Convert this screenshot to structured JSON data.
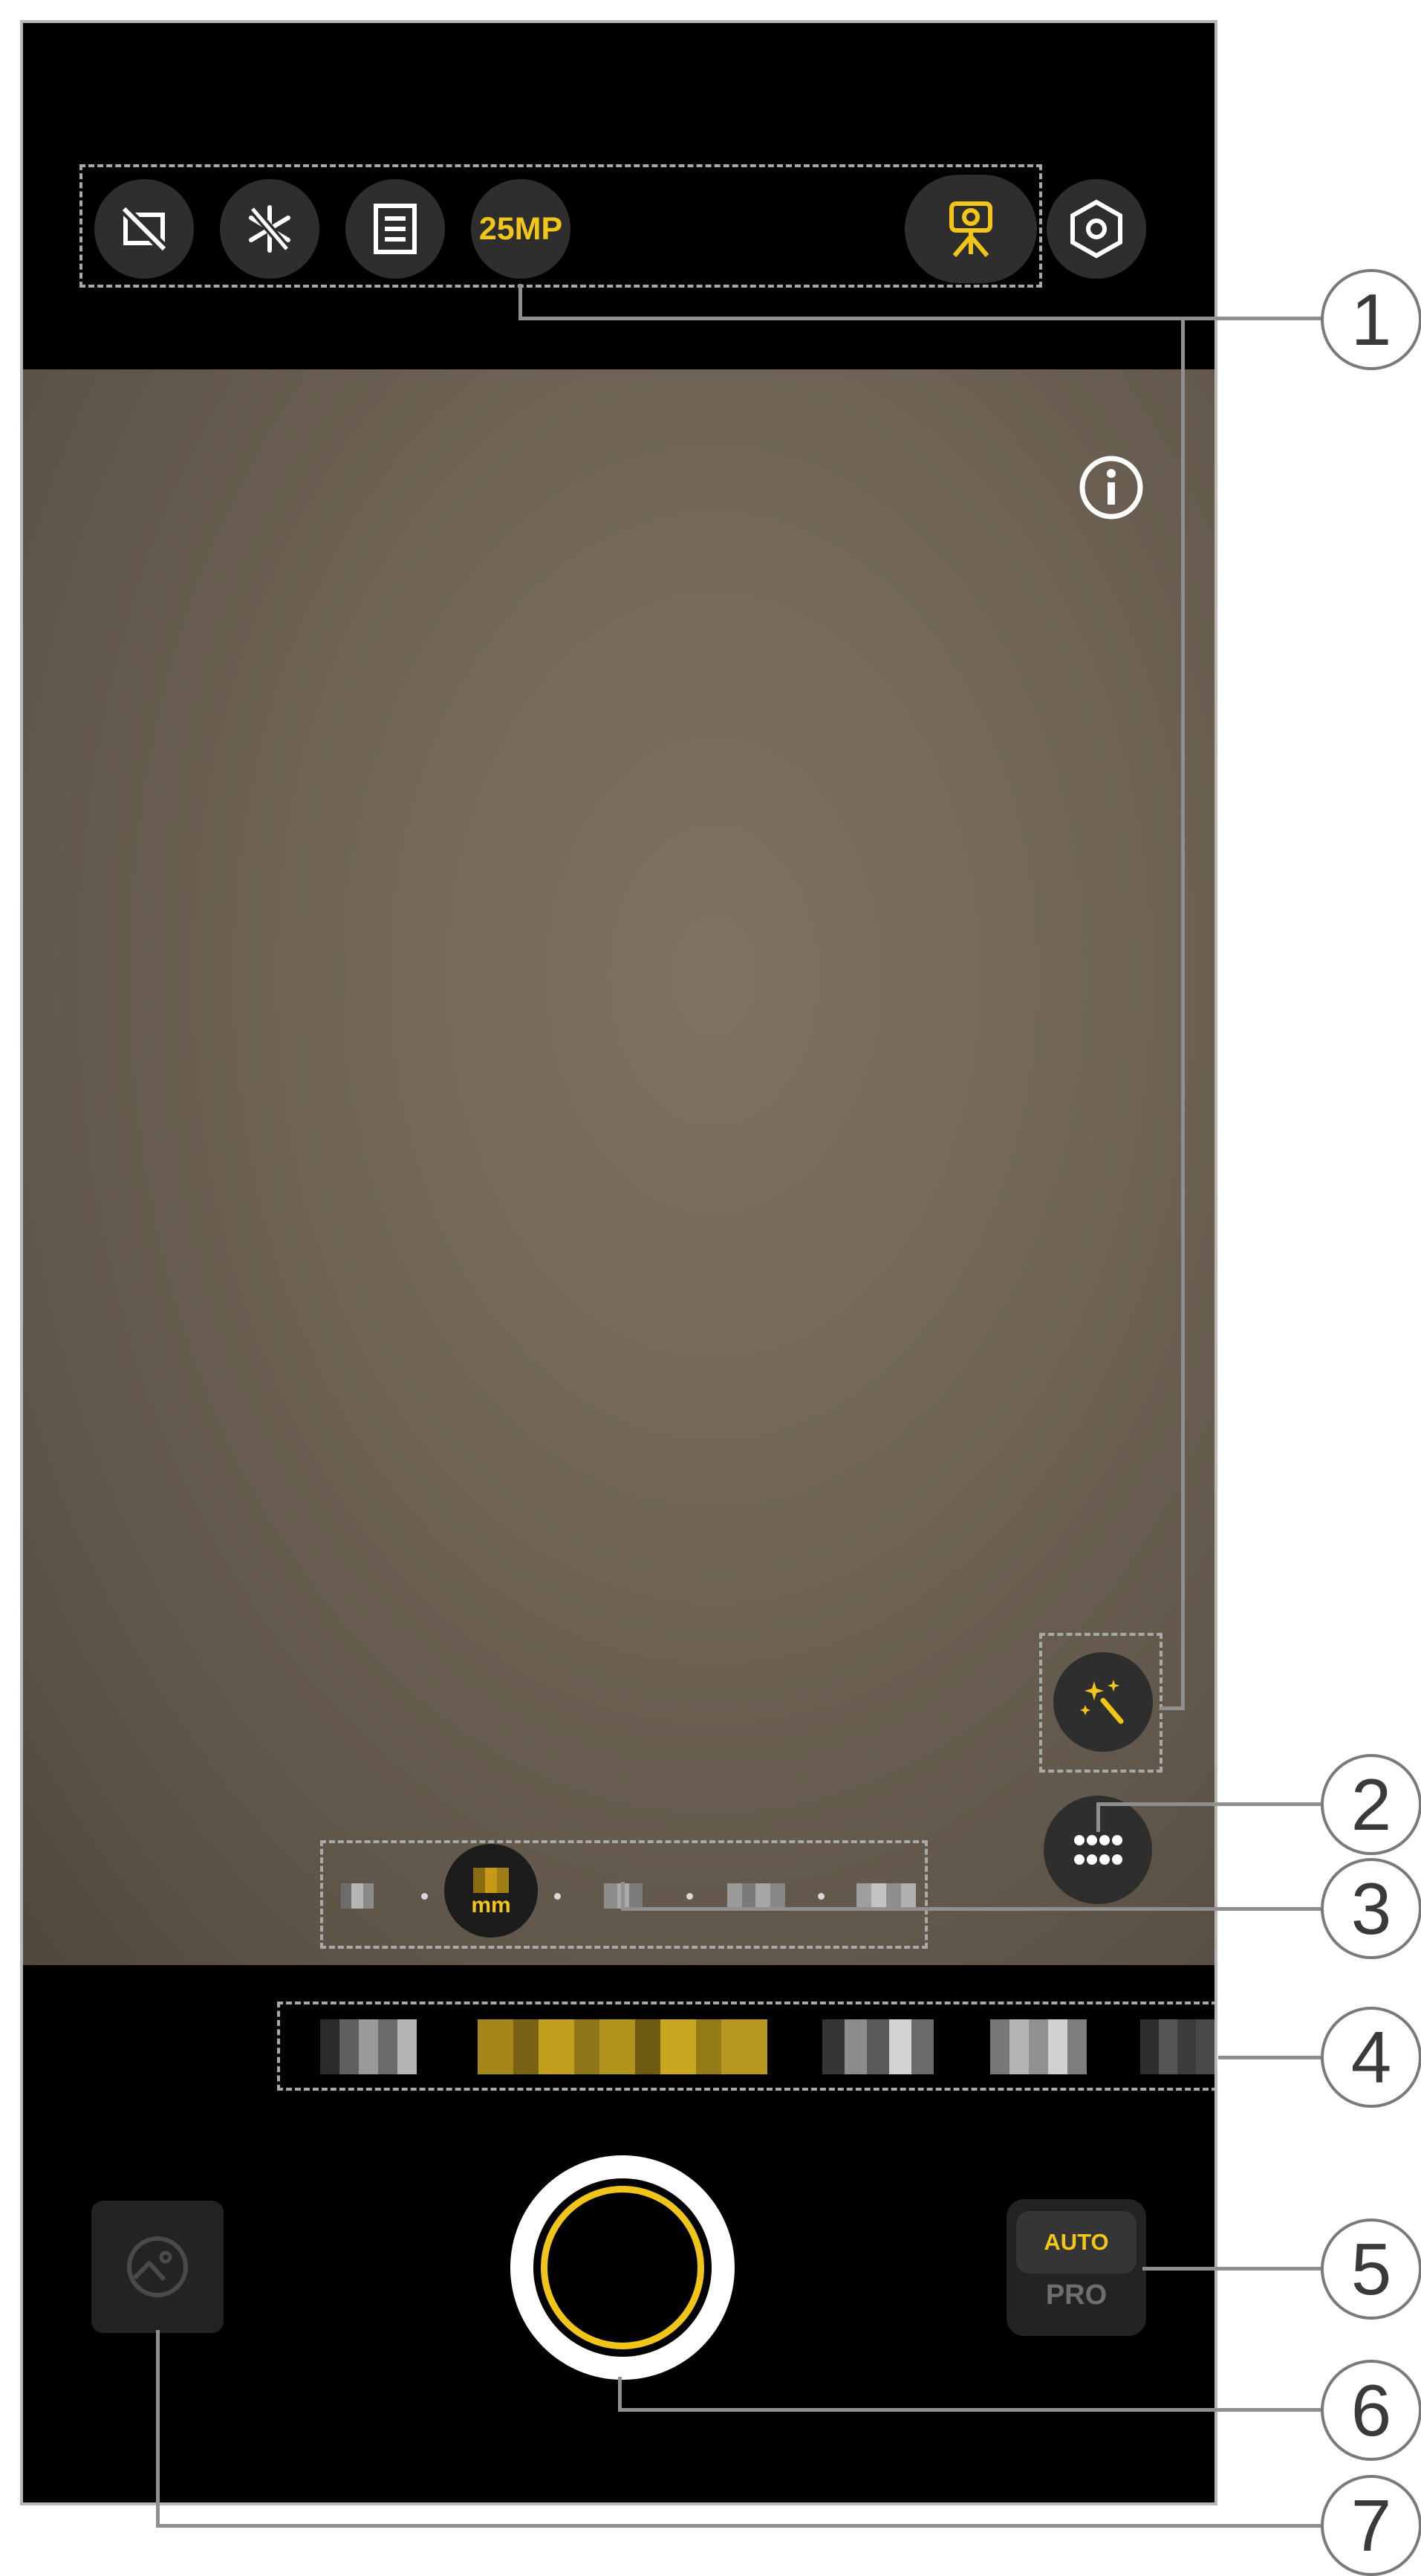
{
  "top_toolbar": {
    "resolution_label": "25MP",
    "icons": [
      "frame-off-icon",
      "flash-off-icon",
      "menu-list-icon",
      "camera-on-tripod-icon",
      "settings-hexagon-icon"
    ]
  },
  "viewfinder": {
    "info_icon": "info-icon",
    "magic_icon": "sparkle-wand-icon",
    "more_icon": "grid-dots-icon"
  },
  "zoom_bar": {
    "selected_unit": "mm"
  },
  "bottom_bar": {
    "mode_auto": "AUTO",
    "mode_pro": "PRO",
    "gallery_icon": "gallery-icon"
  },
  "callouts": [
    "1",
    "2",
    "3",
    "4",
    "5",
    "6",
    "7"
  ],
  "colors": {
    "accent": "#f2c619",
    "button_bg": "#2e2e2e",
    "viewfinder": "#6b6052"
  }
}
